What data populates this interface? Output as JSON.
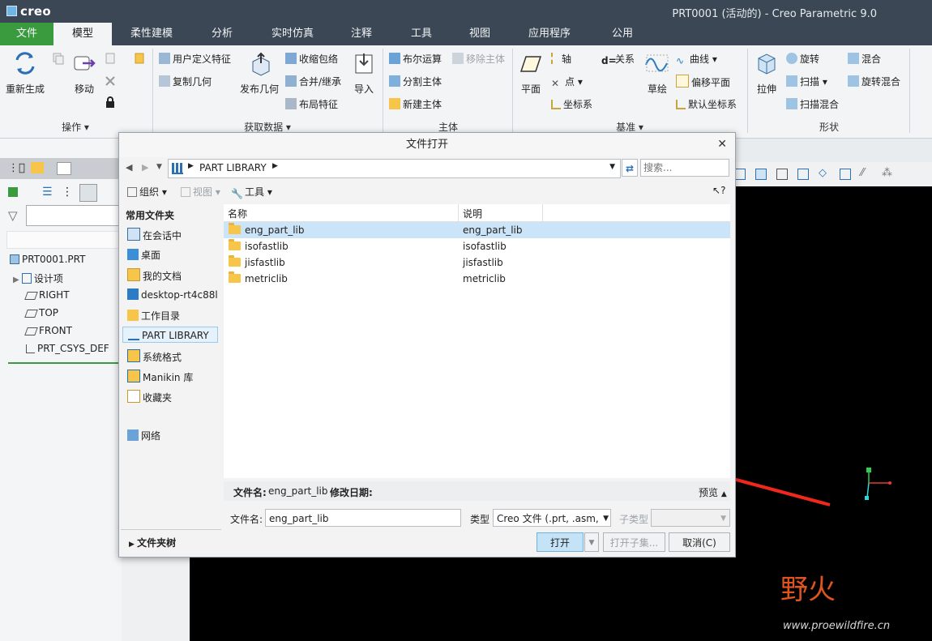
{
  "app": {
    "logo": "creo",
    "window_title": "PRT0001 (活动的) - Creo Parametric 9.0"
  },
  "menu_tabs": [
    {
      "label": "文件"
    },
    {
      "label": "模型"
    },
    {
      "label": "柔性建模"
    },
    {
      "label": "分析"
    },
    {
      "label": "实时仿真"
    },
    {
      "label": "注释"
    },
    {
      "label": "工具"
    },
    {
      "label": "视图"
    },
    {
      "label": "应用程序"
    },
    {
      "label": "公用"
    }
  ],
  "ribbon": {
    "ops": {
      "regen": "重新生成",
      "move": "移动",
      "group": "操作"
    },
    "getdata": {
      "udf": "用户定义特征",
      "copy_geom": "复制几何",
      "publish": "发布几何",
      "shrink": "收缩包络",
      "merge": "合并/继承",
      "layout": "布局特征",
      "import": "导入",
      "group": "获取数据"
    },
    "body": {
      "boolean": "布尔运算",
      "split": "分割主体",
      "new": "新建主体",
      "remove": "移除主体",
      "group": "主体"
    },
    "datum": {
      "plane": "平面",
      "axis": "轴",
      "point": "点",
      "csys": "坐标系",
      "relation": "关系",
      "sketch": "草绘",
      "curve": "曲线",
      "offset_plane": "偏移平面",
      "default_csys": "默认坐标系",
      "group": "基准"
    },
    "shapes": {
      "extrude": "拉伸",
      "revolve": "旋转",
      "sweep": "扫描",
      "helical": "扫描混合",
      "blend": "混合",
      "rot_blend": "旋转混合",
      "group": "形状"
    }
  },
  "model_tree": {
    "root": "PRT0001.PRT",
    "items": [
      "设计项",
      "RIGHT",
      "TOP",
      "FRONT",
      "PRT_CSYS_DEF"
    ]
  },
  "dialog": {
    "title": "文件打开",
    "address": "PART LIBRARY",
    "search_placeholder": "搜索...",
    "toolbar": {
      "organize": "组织",
      "view": "视图",
      "tools": "工具",
      "help": "?"
    },
    "nav_header": "常用文件夹",
    "nav_items": [
      "在会话中",
      "桌面",
      "我的文档",
      "desktop-rt4c88l",
      "工作目录",
      "PART LIBRARY",
      "系统格式",
      "Manikin 库",
      "收藏夹",
      "网络"
    ],
    "folder_tree": "文件夹树",
    "columns": {
      "name": "名称",
      "desc": "说明"
    },
    "files": [
      {
        "name": "eng_part_lib",
        "desc": "eng_part_lib"
      },
      {
        "name": "isofastlib",
        "desc": "isofastlib"
      },
      {
        "name": "jisfastlib",
        "desc": "jisfastlib"
      },
      {
        "name": "metriclib",
        "desc": "metriclib"
      }
    ],
    "info": {
      "name_label": "文件名:",
      "name_value": "eng_part_lib",
      "date_label": "修改日期:",
      "preview": "预览"
    },
    "filename_label": "文件名:",
    "filename_value": "eng_part_lib",
    "type_label": "类型",
    "type_value": "Creo 文件 (.prt, .asm,",
    "subtype_label": "子类型",
    "buttons": {
      "open": "打开",
      "open_subset": "打开子集...",
      "cancel": "取消(C)"
    }
  },
  "watermark": {
    "logo": "野火",
    "url": "www.proewildfire.cn"
  },
  "colors": {
    "titlebar": "#3b4754",
    "file_tab": "#3a9b3e",
    "selection": "#cce4f7",
    "red_arrow": "#f0271c",
    "yellow_arrow": "#f4b400"
  }
}
